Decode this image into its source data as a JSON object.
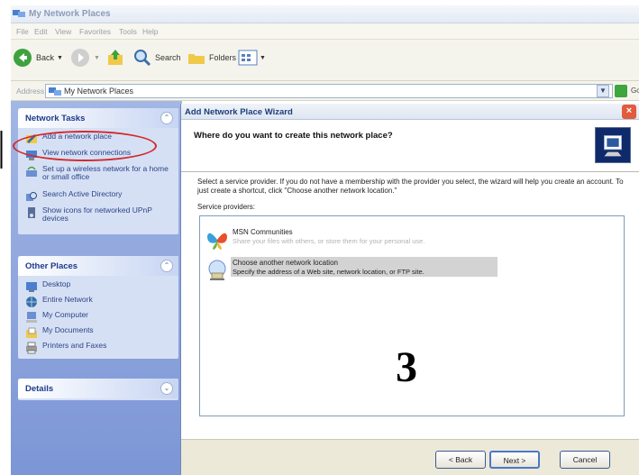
{
  "window": {
    "title": "My Network Places"
  },
  "menu": [
    "File",
    "Edit",
    "View",
    "Favorites",
    "Tools",
    "Help"
  ],
  "toolbar": {
    "back_label": "Back",
    "search_label": "Search",
    "folders_label": "Folders"
  },
  "address": {
    "label": "Address",
    "value": "My Network Places",
    "go_label": "Go"
  },
  "network_tasks": {
    "title": "Network Tasks",
    "items": [
      "Add a network place",
      "View network connections",
      "Set up a wireless network for a home or small office",
      "Search Active Directory",
      "Show icons for networked UPnP devices"
    ]
  },
  "other_places": {
    "title": "Other Places",
    "items": [
      "Desktop",
      "Entire Network",
      "My Computer",
      "My Documents",
      "Printers and Faxes"
    ]
  },
  "details": {
    "title": "Details"
  },
  "wizard": {
    "title": "Add Network Place Wizard",
    "question": "Where do you want to create this network place?",
    "description": "Select a service provider. If you do not have a membership with the provider you select, the wizard will help you create an account. To just create a shortcut, click \"Choose another network location.\"",
    "providers_label": "Service providers:",
    "providers": [
      {
        "name": "MSN Communities",
        "desc": "Share your files with others, or store them for your personal use."
      },
      {
        "name": "Choose another network location",
        "desc": "Specify the address of a Web site, network location, or FTP site."
      }
    ],
    "step_number": "3",
    "buttons": {
      "back": "< Back",
      "next": "Next >",
      "cancel": "Cancel"
    }
  },
  "colors": {
    "highlight_oval": "#d22a2a",
    "task_pane": "#7c96d6",
    "selection": "#d3d3d3"
  }
}
